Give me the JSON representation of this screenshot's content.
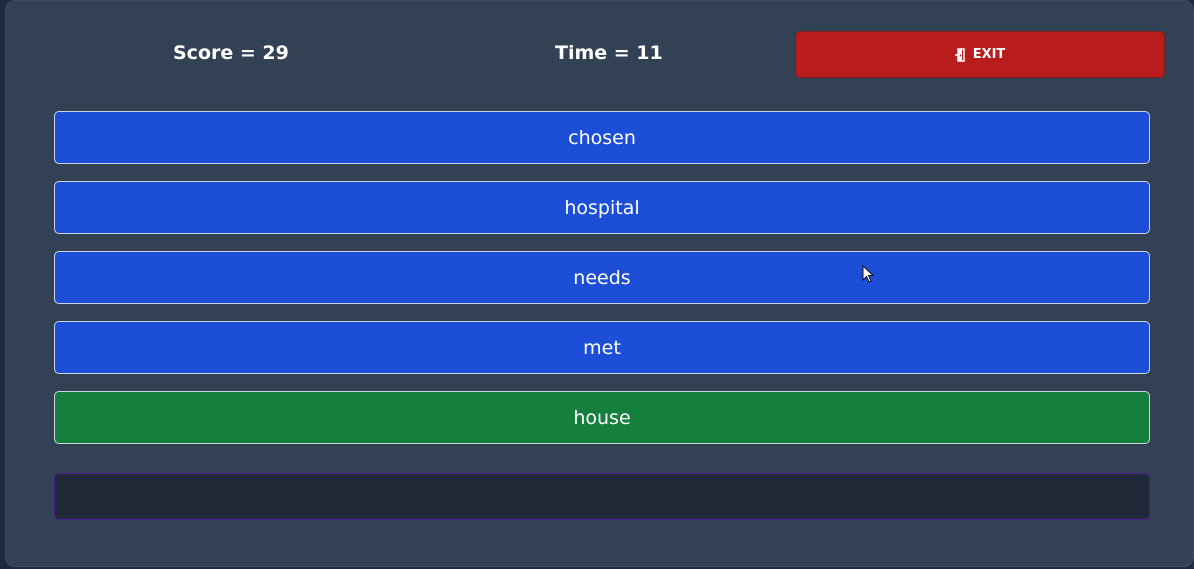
{
  "header": {
    "score_text": "Score = 29",
    "time_text": "Time = 11",
    "exit_label": "EXIT",
    "exit_icon": "door-exit-icon"
  },
  "choices": [
    {
      "label": "chosen",
      "state": "default"
    },
    {
      "label": "hospital",
      "state": "default"
    },
    {
      "label": "needs",
      "state": "default"
    },
    {
      "label": "met",
      "state": "default"
    },
    {
      "label": "house",
      "state": "selected"
    }
  ],
  "answer_input": {
    "value": "",
    "placeholder": ""
  },
  "colors": {
    "choice_default": "#1d4ed8",
    "choice_selected": "#15803d",
    "exit_button": "#b91c1c",
    "panel_bg": "#334155",
    "input_bg": "#1f2937"
  }
}
